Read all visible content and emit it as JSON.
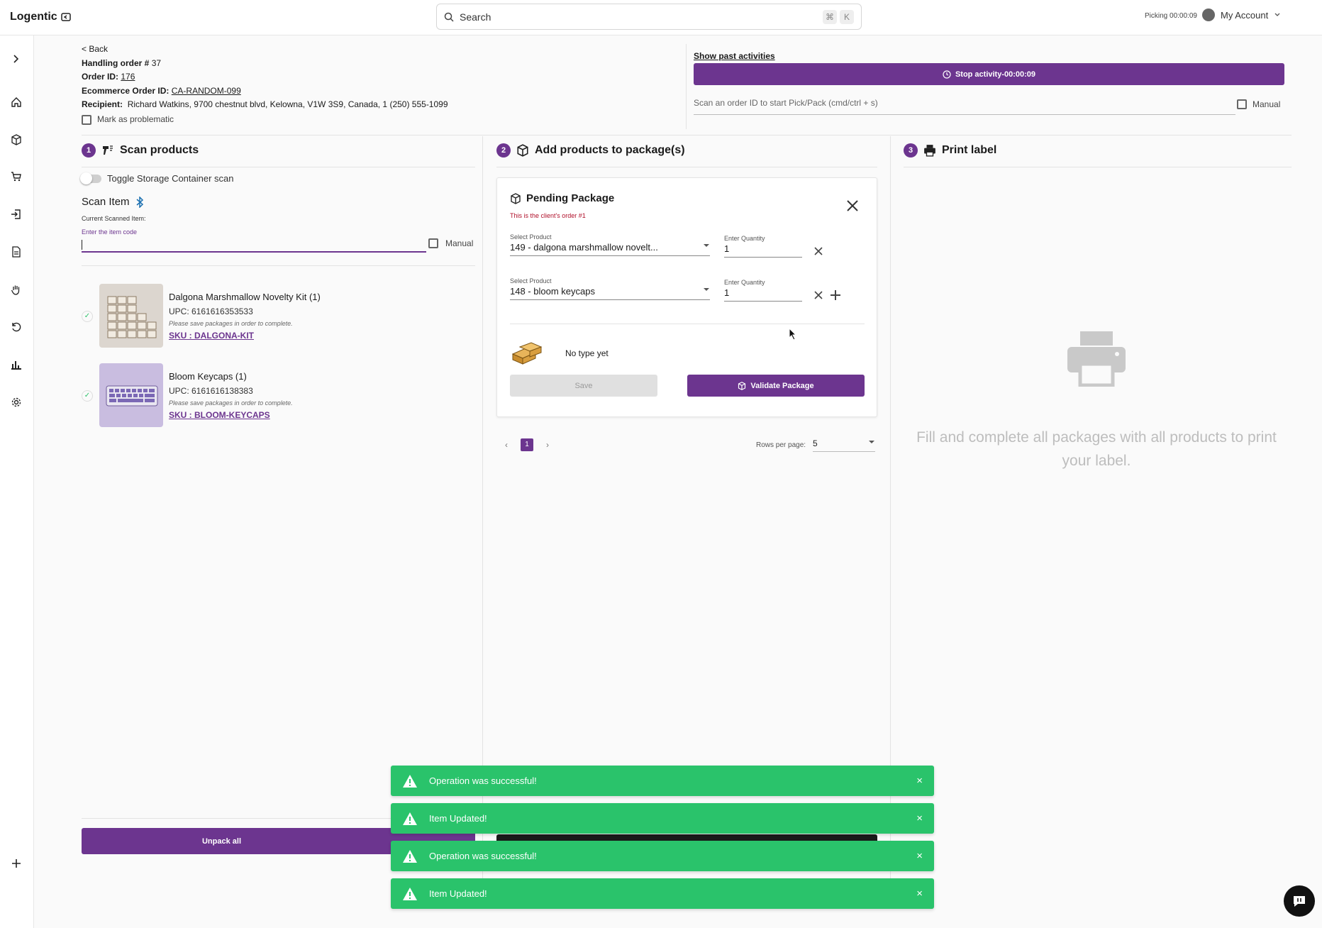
{
  "app": {
    "name": "Logentic"
  },
  "search": {
    "placeholder": "Search",
    "kbd1": "⌘",
    "kbd2": "K"
  },
  "topbar": {
    "picking": "Picking 00:00:09",
    "account": "My Account"
  },
  "header": {
    "back": "< Back",
    "handling_label": "Handling order #",
    "handling_value": "37",
    "order_id_label": "Order ID:",
    "order_id_value": "176",
    "ecom_label": "Ecommerce Order ID:",
    "ecom_value": "CA-RANDOM-099",
    "recipient_label": "Recipient:",
    "recipient_value": "Richard Watkins, 9700 chestnut blvd, Kelowna, V1W 3S9, Canada,  1 (250) 555-1099",
    "problematic": "Mark as problematic"
  },
  "activity": {
    "show_past": "Show past activities",
    "stop": "Stop activity-00:00:09",
    "scan_placeholder": "Scan an order ID to start Pick/Pack (cmd/ctrl + s)",
    "manual": "Manual"
  },
  "steps": {
    "s1": {
      "num": "1",
      "label": "Scan products"
    },
    "s2": {
      "num": "2",
      "label": "Add products to package(s)"
    },
    "s3": {
      "num": "3",
      "label": "Print label"
    }
  },
  "scan": {
    "toggle": "Toggle Storage Container scan",
    "title": "Scan Item",
    "current": "Current Scanned Item:",
    "code_label": "Enter the item code",
    "manual": "Manual"
  },
  "items": [
    {
      "name": "Dalgona Marshmallow Novelty Kit (1)",
      "upc": "UPC: 6161616353533",
      "note": "Please save packages in order to complete.",
      "sku": "SKU : DALGONA-KIT"
    },
    {
      "name": "Bloom Keycaps (1)",
      "upc": "UPC: 6161616138383",
      "note": "Please save packages in order to complete.",
      "sku": "SKU : BLOOM-KEYCAPS"
    }
  ],
  "package": {
    "title": "Pending Package",
    "subtitle": "This is the client's order #1",
    "rows": [
      {
        "product_label": "Select Product",
        "product": "149 - dalgona marshmallow novelt...",
        "qty_label": "Enter Quantity",
        "qty": "1"
      },
      {
        "product_label": "Select Product",
        "product": "148 - bloom keycaps",
        "qty_label": "Enter Quantity",
        "qty": "1"
      }
    ],
    "type": "No type yet",
    "save": "Save",
    "validate": "Validate Package"
  },
  "pager": {
    "page": "1",
    "rows_label": "Rows per page:",
    "rows_value": "5"
  },
  "print": {
    "message": "Fill and complete all packages with all products to print your label."
  },
  "actions": {
    "unpack": "Unpack all"
  },
  "toasts": [
    {
      "text": "Operation was successful!"
    },
    {
      "text": "Item Updated!"
    },
    {
      "text": "Operation was successful!"
    },
    {
      "text": "Item Updated!"
    }
  ],
  "colors": {
    "accent": "#6c358f",
    "success": "#2ac36b"
  }
}
